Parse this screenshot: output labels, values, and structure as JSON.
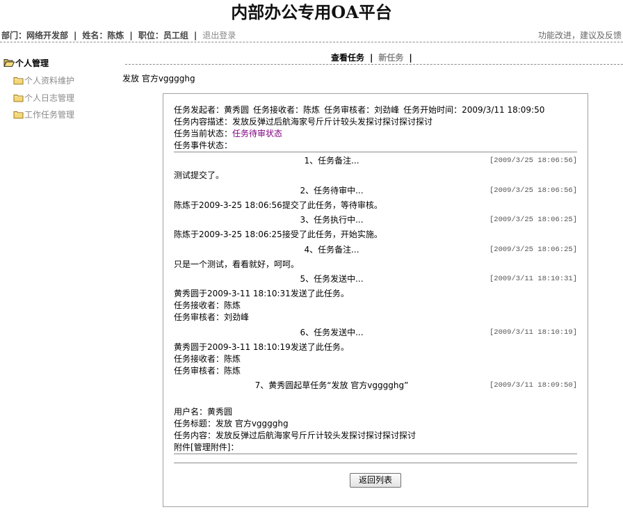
{
  "header": {
    "title": "内部办公专用OA平台",
    "department": "部门：网络开发部",
    "name": "姓名：陈炼",
    "position": "职位：员工组",
    "separator": "|",
    "logout": "退出登录",
    "feedback": "功能改进，建议及反馈"
  },
  "sidebar": {
    "title": "个人管理",
    "items": [
      "个人资料维护",
      "个人日志管理",
      "工作任务管理"
    ]
  },
  "tabs": {
    "view": "查看任务",
    "new": "新任务",
    "separator": "|"
  },
  "task": {
    "title": "发放 官方vgggghg",
    "info": {
      "initiator_label": "任务发起者：",
      "initiator": "黄秀圆",
      "receiver_label": "任务接收者：",
      "receiver": "陈炼",
      "reviewer_label": "任务审核者：",
      "reviewer": "刘劲峰",
      "start_label": "任务开始时间：",
      "start_time": "2009/3/11 18:09:50",
      "desc_label": "任务内容描述：",
      "desc": "发放反弹过后航海家号斤斤计较头发探讨探讨探讨探讨",
      "status_label": "任务当前状态：",
      "status": "任务待审状态",
      "event_label": "任务事件状态："
    }
  },
  "events": [
    {
      "title": "1、任务备注...",
      "time": "[2009/3/25 18:06:56]",
      "lines": [
        "测试提交了。"
      ]
    },
    {
      "title": "2、任务待审中...",
      "time": "[2009/3/25 18:06:56]",
      "lines": [
        "陈炼于2009-3-25 18:06:56提交了此任务，等待审核。"
      ]
    },
    {
      "title": "3、任务执行中...",
      "time": "[2009/3/25 18:06:25]",
      "lines": [
        "陈炼于2009-3-25 18:06:25接受了此任务，开始实施。"
      ]
    },
    {
      "title": "4、任务备注...",
      "time": "[2009/3/25 18:06:25]",
      "lines": [
        "只是一个测试，看看就好，呵呵。"
      ]
    },
    {
      "title": "5、任务发送中...",
      "time": "[2009/3/11 18:10:31]",
      "lines": [
        "黄秀圆于2009-3-11 18:10:31发送了此任务。",
        "任务接收者：陈炼",
        "任务审核者：刘劲峰"
      ]
    },
    {
      "title": "6、任务发送中...",
      "time": "[2009/3/11 18:10:19]",
      "lines": [
        "黄秀圆于2009-3-11 18:10:19发送了此任务。",
        "任务接收者：陈炼",
        "任务审核者：陈炼"
      ]
    },
    {
      "title": "7、黄秀圆起草任务“发放 官方vgggghg”",
      "time": "[2009/3/11 18:09:50]",
      "lines": [
        "用户名：黄秀圆",
        "任务标题：发放 官方vgggghg",
        "任务内容：发放反弹过后航海家号斤斤计较头发探讨探讨探讨探讨"
      ],
      "attachment": {
        "prefix": "附件[",
        "link": "管理附件",
        "suffix": "]："
      }
    }
  ],
  "actions": {
    "back": "返回列表"
  },
  "icons": {
    "sidebar_group": "folder-open-icon",
    "sidebar_item": "folder-icon"
  },
  "colors": {
    "status": "#800080",
    "muted": "#888888",
    "divider": "#8a8a8a"
  }
}
